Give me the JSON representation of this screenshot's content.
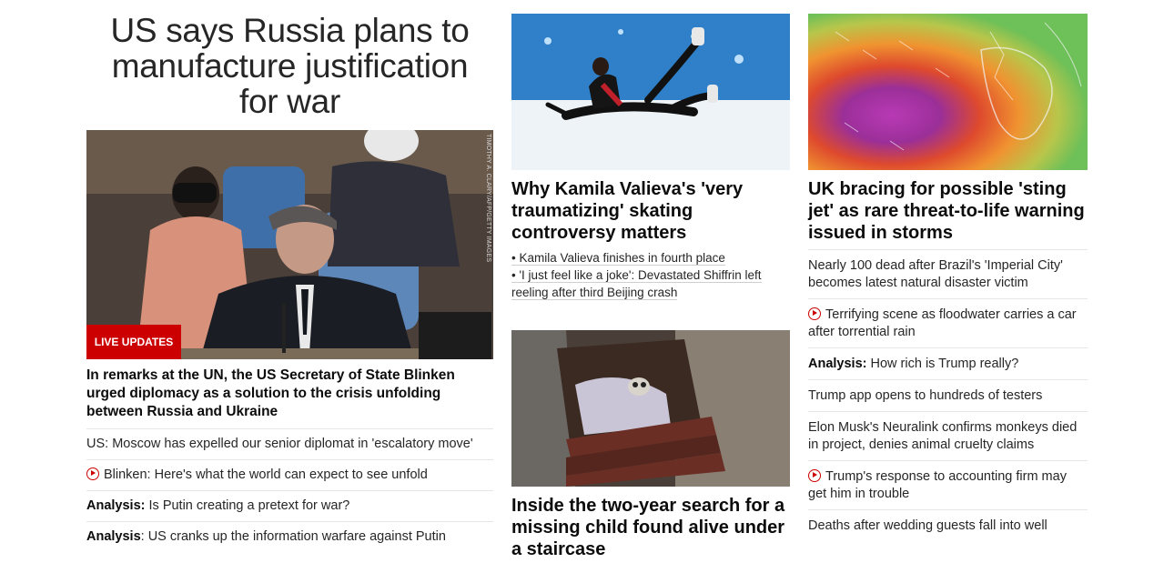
{
  "col1": {
    "headline": "US says Russia plans to manufacture justification for war",
    "badge": "LIVE UPDATES",
    "photo_credit": "TIMOTHY A. CLARY/AFP/GETTY IMAGES",
    "lead": "In remarks at the UN, the US Secretary of State Blinken urged diplomacy as a solution to the crisis unfolding between Russia and Ukraine",
    "items": [
      {
        "prefix": "",
        "text": "US: Moscow has expelled our senior diplomat in 'escalatory move'",
        "video": false
      },
      {
        "prefix": "",
        "text": "Blinken: Here's what the world can expect to see unfold",
        "video": true
      },
      {
        "prefix": "Analysis:",
        "text": " Is Putin creating a pretext for war?",
        "video": false
      },
      {
        "prefix": "Analysis",
        "text": ": US cranks up the information warfare against Putin",
        "video": false
      }
    ]
  },
  "col2": {
    "story1": {
      "headline": "Why Kamila Valieva's 'very traumatizing' skating controversy matters",
      "links": [
        "• Kamila Valieva finishes in fourth place",
        "• 'I just feel like a joke': Devastated Shiffrin left reeling after third Beijing crash"
      ]
    },
    "story2": {
      "headline": "Inside the two-year search for a missing child found alive under a staircase"
    }
  },
  "col3": {
    "headline": "UK bracing for possible 'sting jet' as rare threat-to-life warning issued in storms",
    "items": [
      {
        "prefix": "",
        "text": "Nearly 100 dead after Brazil's 'Imperial City' becomes latest natural disaster victim",
        "video": false
      },
      {
        "prefix": "",
        "text": "Terrifying scene as floodwater carries a car after torrential rain",
        "video": true
      },
      {
        "prefix": "Analysis:",
        "text": " How rich is Trump really?",
        "video": false
      },
      {
        "prefix": "",
        "text": "Trump app opens to hundreds of testers",
        "video": false
      },
      {
        "prefix": "",
        "text": "Elon Musk's Neuralink confirms monkeys died in project, denies animal cruelty claims",
        "video": false
      },
      {
        "prefix": "",
        "text": "Trump's response to accounting firm may get him in trouble",
        "video": true
      },
      {
        "prefix": "",
        "text": "Deaths after wedding guests fall into well",
        "video": false
      }
    ]
  }
}
